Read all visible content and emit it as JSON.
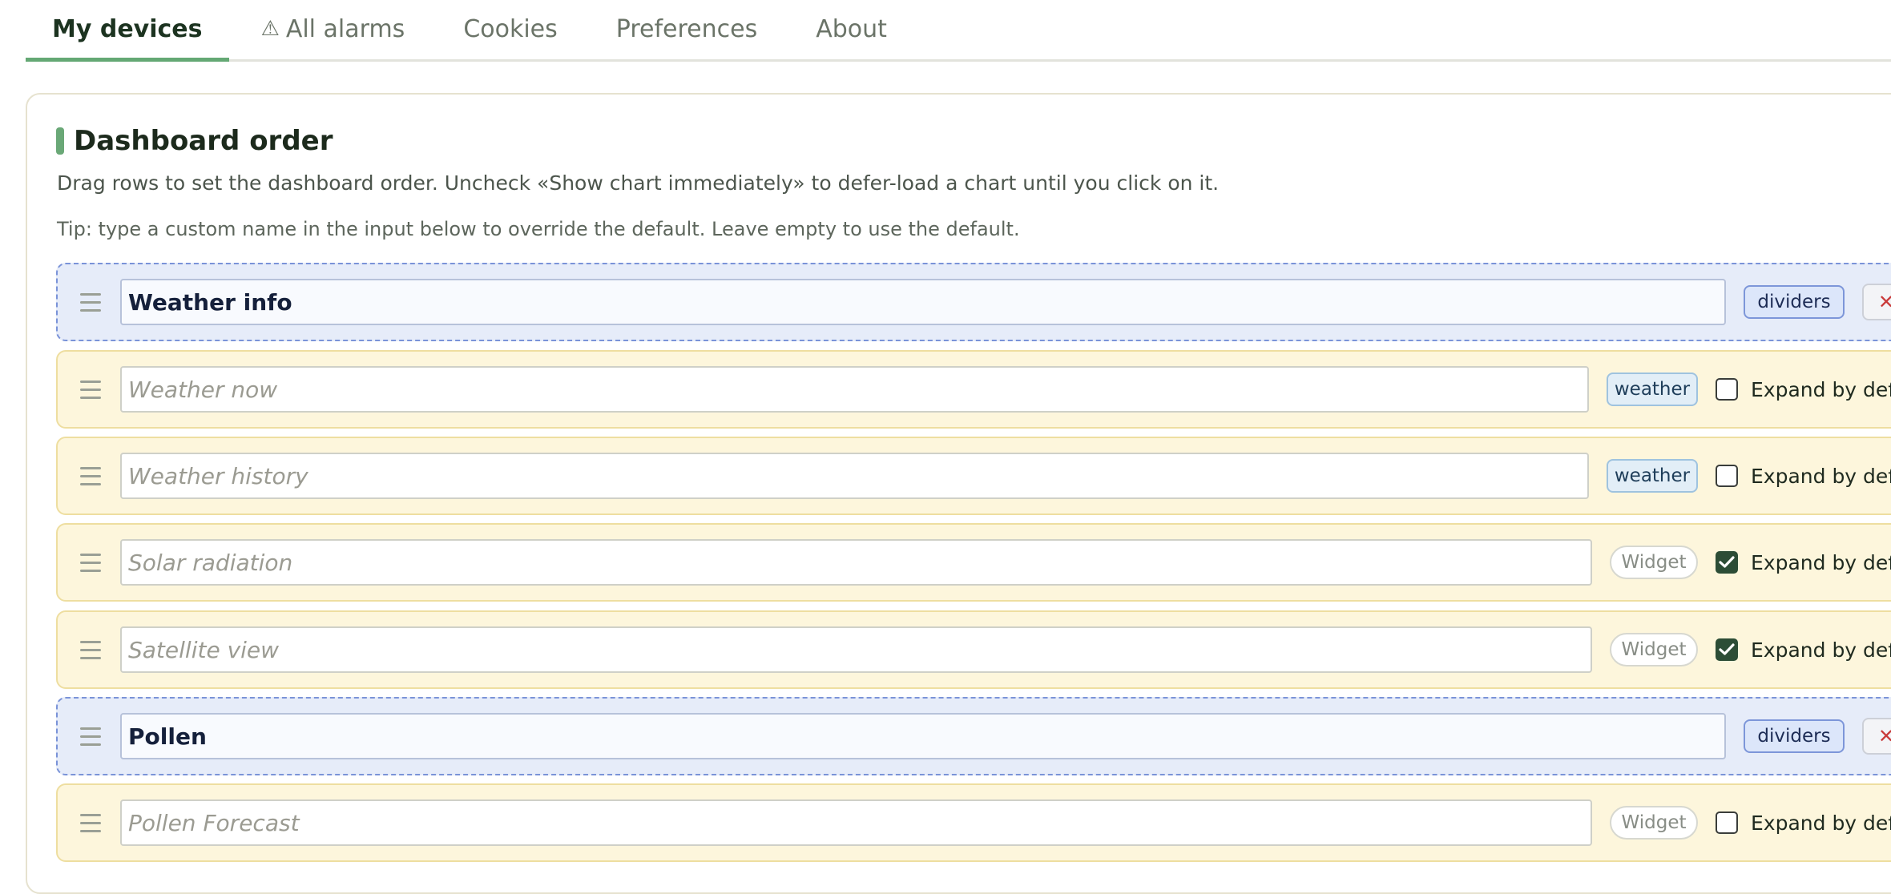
{
  "tabs": [
    {
      "label": "My devices",
      "active": true,
      "icon": null
    },
    {
      "label": "All alarms",
      "active": false,
      "icon": "warning-icon"
    },
    {
      "label": "Cookies",
      "active": false,
      "icon": null
    },
    {
      "label": "Preferences",
      "active": false,
      "icon": null
    },
    {
      "label": "About",
      "active": false,
      "icon": null
    }
  ],
  "panel": {
    "title": "Dashboard order",
    "description": "Drag rows to set the dashboard order. Uncheck «Show chart immediately» to defer-load a chart until you click on it.",
    "tip": "Tip: type a custom name in the input below to override the default. Leave empty to use the default."
  },
  "rows": [
    {
      "kind": "divider",
      "value": "Weather info",
      "placeholder": "",
      "tag": "dividers",
      "remove": "✕"
    },
    {
      "kind": "item",
      "value": "",
      "placeholder": "Weather now",
      "tag": "weather",
      "checked": false,
      "check_label": "Expand by default"
    },
    {
      "kind": "item",
      "value": "",
      "placeholder": "Weather history",
      "tag": "weather",
      "checked": false,
      "check_label": "Expand by default"
    },
    {
      "kind": "item",
      "value": "",
      "placeholder": "Solar radiation",
      "tag": "Widget",
      "checked": true,
      "check_label": "Expand by default"
    },
    {
      "kind": "item",
      "value": "",
      "placeholder": "Satellite view",
      "tag": "Widget",
      "checked": true,
      "check_label": "Expand by default"
    },
    {
      "kind": "divider",
      "value": "Pollen",
      "placeholder": "",
      "tag": "dividers",
      "remove": "✕"
    },
    {
      "kind": "item",
      "value": "",
      "placeholder": "Pollen Forecast",
      "tag": "Widget",
      "checked": false,
      "check_label": "Expand by default"
    }
  ],
  "colors": {
    "accent": "#64a874",
    "divider_bg": "#e6ecf9",
    "item_bg": "#fdf6dc",
    "checkbox_checked": "#2c4d36",
    "remove_icon": "#c93a3a"
  }
}
